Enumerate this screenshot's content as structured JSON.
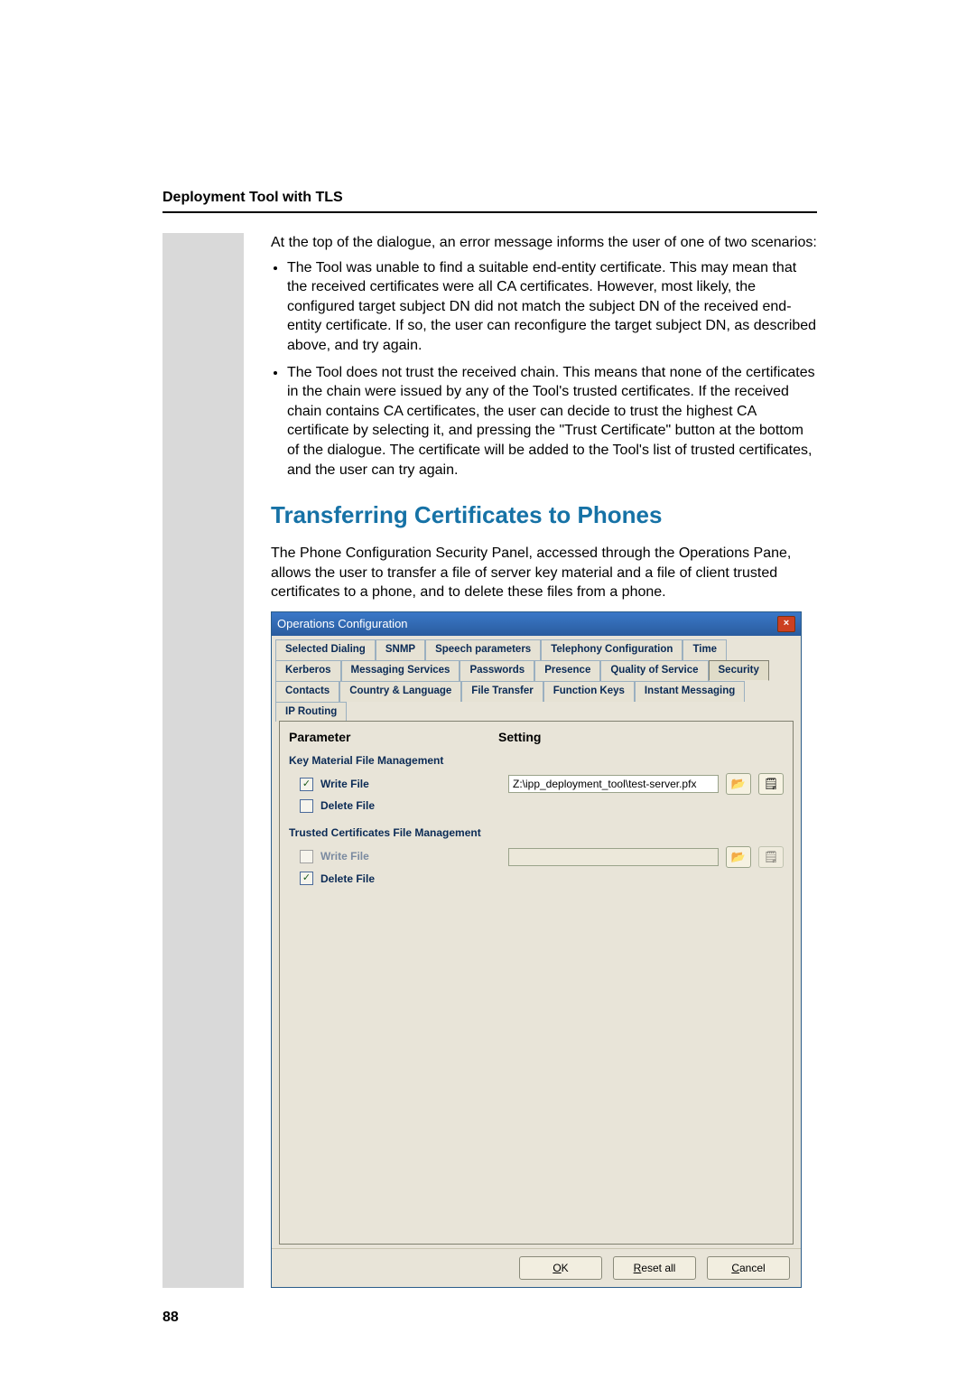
{
  "header": {
    "section_title": "Deployment Tool with TLS"
  },
  "body": {
    "intro": "At the top of the dialogue, an error message informs the user of one of two scenarios:",
    "bullets": [
      "The Tool was unable to find a suitable end-entity certificate.  This may mean that the received certificates were all CA certificates. However, most likely, the configured target subject DN did not match the subject DN of the received end-entity certificate. If so, the user can reconfigure the target subject DN, as described above, and try again.",
      "The Tool does not trust the received chain.  This means that none of the certificates in the chain were issued by any of the Tool's trusted certificates.  If the received chain contains CA certificates, the user can decide to trust the highest CA certificate by selecting it, and pressing the \"Trust Certificate\" button at the bottom of the dialogue.  The certificate will be added to the Tool's list of trusted certificates, and the user can try again."
    ],
    "heading": "Transferring Certificates to Phones",
    "para": "The Phone Configuration Security Panel, accessed through the Operations Pane, allows the user to transfer a file of server key material and a file of client trusted certificates to a phone, and to delete these files from a phone."
  },
  "shot": {
    "title": "Operations Configuration",
    "tabs_row1": [
      "Selected Dialing",
      "SNMP",
      "Speech parameters",
      "Telephony Configuration",
      "Time"
    ],
    "tabs_row2": [
      "Kerberos",
      "Messaging Services",
      "Passwords",
      "Presence",
      "Quality of Service",
      "Security"
    ],
    "tabs_row3": [
      "Contacts",
      "Country & Language",
      "File Transfer",
      "Function Keys",
      "Instant Messaging",
      "IP Routing"
    ],
    "col_parameter": "Parameter",
    "col_setting": "Setting",
    "group1": "Key Material File Management",
    "write_file_label": "Write File",
    "delete_file_label": "Delete File",
    "key_path": "Z:\\ipp_deployment_tool\\test-server.pfx",
    "group2": "Trusted Certificates File Management",
    "buttons": {
      "ok_pre": "",
      "ok_ul": "O",
      "ok_post": "K",
      "reset_pre": "",
      "reset_ul": "R",
      "reset_post": "eset all",
      "cancel_pre": "",
      "cancel_ul": "C",
      "cancel_post": "ancel"
    }
  },
  "page_number": "88"
}
